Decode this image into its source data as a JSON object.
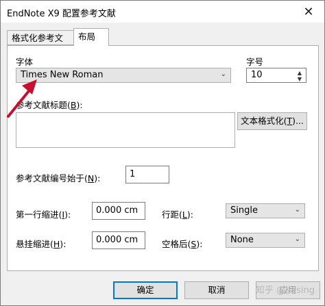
{
  "window": {
    "title": "EndNote X9 配置参考文献",
    "close_glyph": "✕"
  },
  "tabs": [
    {
      "label": "格式化参考文献",
      "active": false
    },
    {
      "label": "布局",
      "active": true
    }
  ],
  "font": {
    "label": "字体",
    "value": "Times New Roman",
    "arrow": "⌄"
  },
  "size": {
    "label": "字号",
    "value": "10",
    "up": "▲",
    "down": "▼"
  },
  "bib_title": {
    "label_pre": "参考文献标题(",
    "key": "B",
    "label_post": "):",
    "value": ""
  },
  "format_text_button": {
    "label_pre": "文本格式化(",
    "key": "T",
    "label_post": ")..."
  },
  "start_number": {
    "label_pre": "参考文献编号始于(",
    "key": "N",
    "label_post": "):",
    "value": "1"
  },
  "first_indent": {
    "label_pre": "第一行缩进(",
    "key": "I",
    "label_post": "):",
    "value": "0.000 cm"
  },
  "hanging_indent": {
    "label_pre": "悬挂缩进(",
    "key": "H",
    "label_post": "):",
    "value": "0.000 cm"
  },
  "line_spacing": {
    "label_pre": "行距(",
    "key": "L",
    "label_post": "):",
    "value": "Single",
    "arrow": "⌄"
  },
  "space_after": {
    "label_pre": "空格后(",
    "key": "S",
    "label_post": "):",
    "value": "None",
    "arrow": "⌄"
  },
  "buttons": {
    "ok": "确定",
    "cancel": "取消",
    "apply": "应用"
  },
  "watermark": "知乎 @Kasing",
  "colors": {
    "dialog_bg": "#f0f0f0",
    "accent": "#0078d7",
    "pointer": "#c8102e"
  }
}
